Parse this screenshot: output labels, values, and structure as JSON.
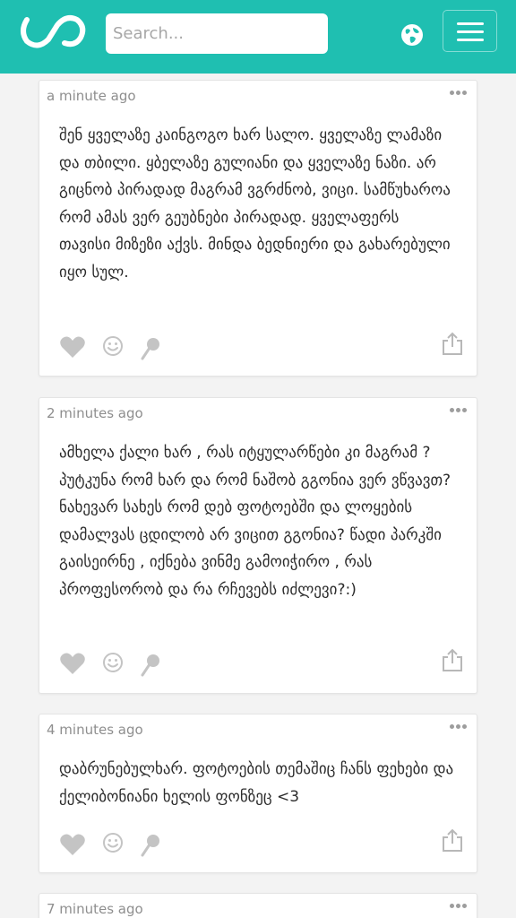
{
  "header": {
    "search_placeholder": "Search...",
    "brand_color": "#1fbfb1",
    "icons": [
      "infinity-logo-icon",
      "globe-icon",
      "hamburger-menu-icon"
    ]
  },
  "comments": [
    {
      "time": "a minute ago",
      "text": "შენ ყველაზე კაინგოგო ხარ სალო. ყველაზე ლამაზი და თბილი. ყბელაზე გულიანი და ყველაზე ნაზი. არ გიცნობ პირადად მაგრამ ვგრძნობ, ვიცი. სამწუხაროა რომ ამას ვერ გეუბნები პირადად. ყველაფერს თავისი მიზეზი აქვს. მინდა ბედნიერი და გახარებული იყო სულ."
    },
    {
      "time": "2 minutes ago",
      "text": "ამხელა ქალი ხარ , რას იტყულარწები კი მაგრამ ? პუტკუნა რომ ხარ და რომ ნაშობ გგონია ვერ ვწვავთ? ნახევარ სახეს რომ დებ ფოტოებში და ლოყების დამალვას ცდილობ არ ვიცით გგონია? წადი პარკში გაისეირნე , იქნება ვინმე გამოიჭირო , რას პროფესორობ და რა რჩევებს იძლევი?:)"
    },
    {
      "time": "4 minutes ago",
      "text": "დაბრუნებულხარ. ფოტოების თემაშიც ჩანს ფეხები და ქელიბონიანი ხელის ფონზეც <3"
    },
    {
      "time": "7 minutes ago",
      "text": ""
    }
  ],
  "comment_actions": [
    "heart-icon",
    "smiley-icon",
    "pin-icon",
    "share-icon"
  ]
}
